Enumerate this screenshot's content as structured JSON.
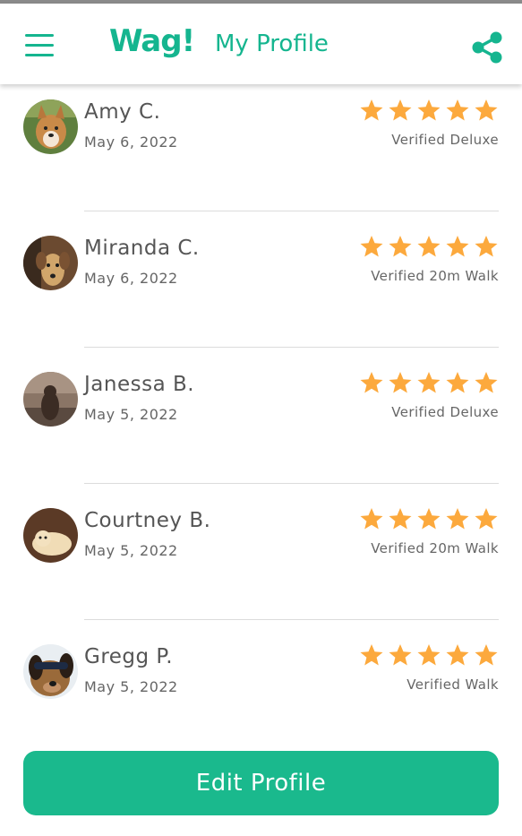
{
  "header": {
    "logo": "Wag!",
    "title": "My Profile"
  },
  "colors": {
    "brand": "#15b58f",
    "star": "#fca93d",
    "button": "#1ab98d"
  },
  "reviews": [
    {
      "name": "Amy C.",
      "date": "May 6, 2022",
      "rating": 5,
      "verified": "Verified Deluxe"
    },
    {
      "name": "Miranda C.",
      "date": "May 6, 2022",
      "rating": 5,
      "verified": "Verified 20m Walk"
    },
    {
      "name": "Janessa B.",
      "date": "May 5, 2022",
      "rating": 5,
      "verified": "Verified Deluxe"
    },
    {
      "name": "Courtney B.",
      "date": "May 5, 2022",
      "rating": 5,
      "verified": "Verified 20m Walk"
    },
    {
      "name": "Gregg P.",
      "date": "May 5, 2022",
      "rating": 5,
      "verified": "Verified Walk"
    }
  ],
  "actions": {
    "edit_profile": "Edit Profile"
  },
  "icons": [
    "menu-icon",
    "share-icon",
    "star-icon"
  ]
}
